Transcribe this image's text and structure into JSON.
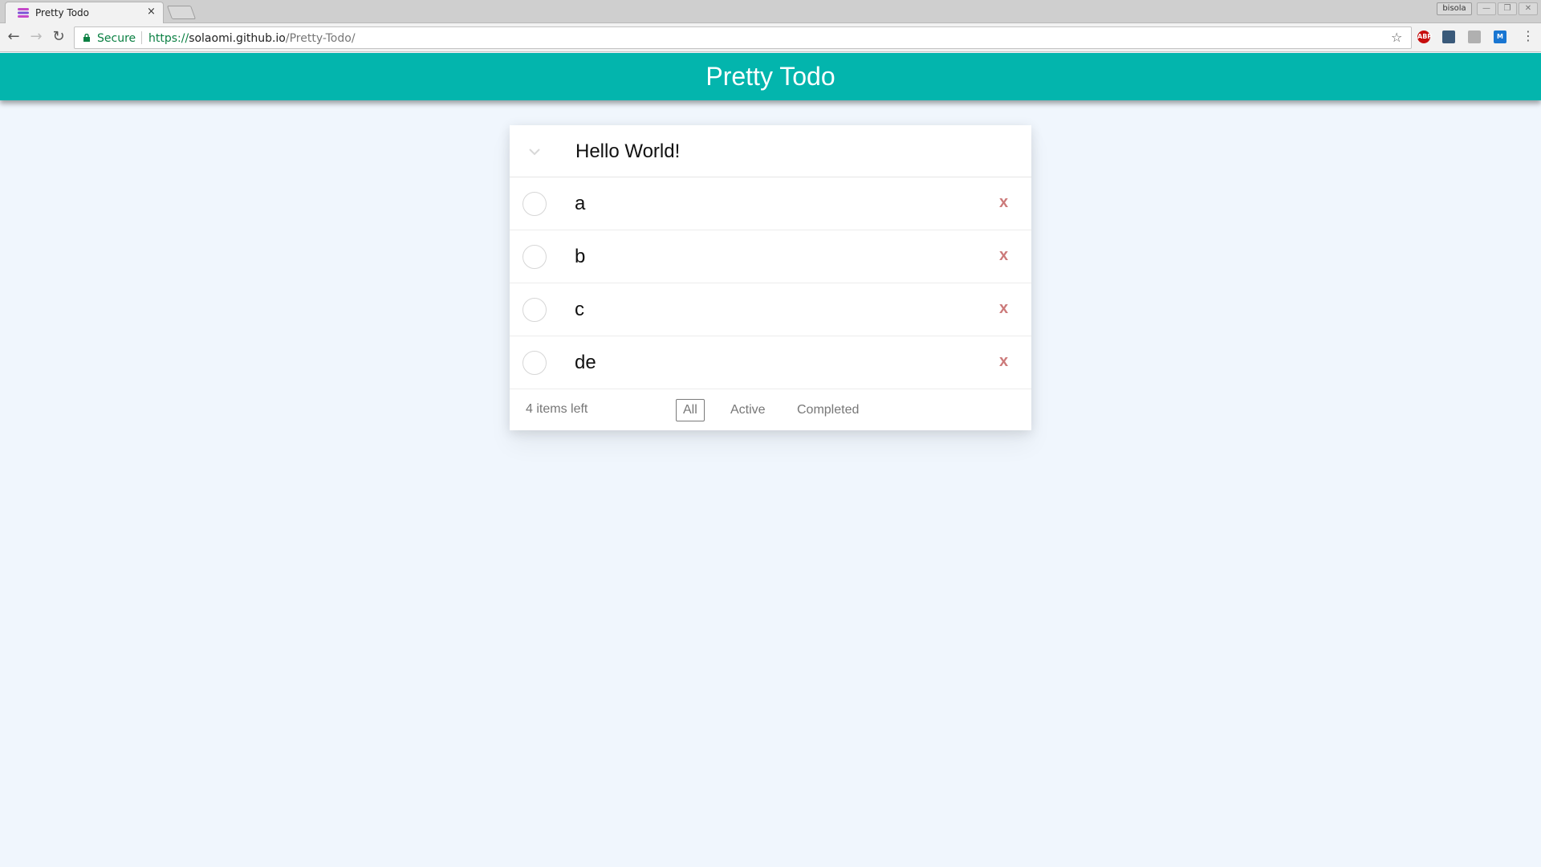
{
  "browser": {
    "tab_title": "Pretty Todo",
    "tab_close": "×",
    "profile_name": "bisola",
    "secure_label": "Secure",
    "url_scheme": "https://",
    "url_host": "solaomi.github.io",
    "url_path": "/Pretty-Todo/",
    "extensions": [
      {
        "icon": "adblock-plus-icon",
        "label": "ABP",
        "color": "#c70d0d"
      },
      {
        "icon": "extension-icon",
        "label": "",
        "color": "#3a5a7a"
      },
      {
        "icon": "printer-icon",
        "label": "",
        "color": "#b0b0b0"
      },
      {
        "icon": "m-extension-icon",
        "label": "M",
        "color": "#1976d2"
      }
    ]
  },
  "app": {
    "title": "Pretty Todo",
    "accent_color": "#03b5ad",
    "background_color": "#f0f6fd",
    "new_todo_value": "Hello World!",
    "todos": [
      {
        "label": "a",
        "completed": false
      },
      {
        "label": "b",
        "completed": false
      },
      {
        "label": "c",
        "completed": false
      },
      {
        "label": "de",
        "completed": false
      }
    ],
    "destroy_label": "x",
    "footer": {
      "items_left": "4 items left",
      "filters": [
        "All",
        "Active",
        "Completed"
      ],
      "selected_filter": "All"
    }
  }
}
